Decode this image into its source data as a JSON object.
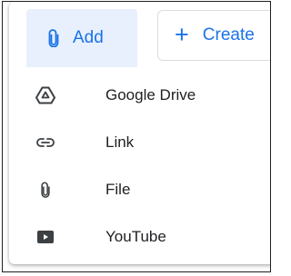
{
  "toolbar": {
    "add_label": "Add",
    "add_icon": "paperclip-icon",
    "create_label": "Create",
    "create_icon": "plus-icon"
  },
  "menu": {
    "items": [
      {
        "label": "Google Drive",
        "icon": "google-drive-icon"
      },
      {
        "label": "Link",
        "icon": "link-icon"
      },
      {
        "label": "File",
        "icon": "paperclip-icon"
      },
      {
        "label": "YouTube",
        "icon": "youtube-icon"
      }
    ]
  },
  "colors": {
    "accent": "#1a73e8",
    "add_background": "#e8f0fe",
    "text": "#202124",
    "icon": "#3c4043"
  }
}
